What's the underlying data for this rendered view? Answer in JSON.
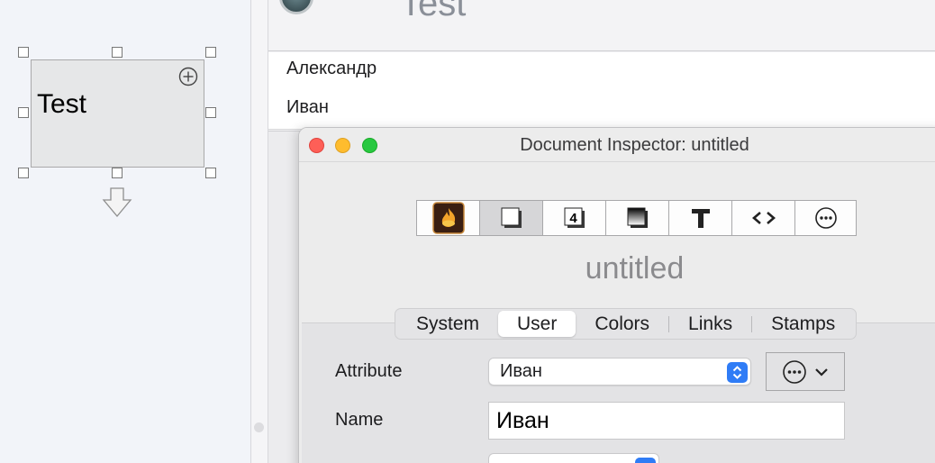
{
  "canvas": {
    "note_title": "Test"
  },
  "main": {
    "title": "Test",
    "list": [
      "Александр",
      "Иван"
    ]
  },
  "inspector": {
    "window_title": "Document Inspector: untitled",
    "toolbar_icons": [
      "document-flame-icon",
      "page-shadow-icon",
      "number-4-icon",
      "gradient-icon",
      "text-T-icon",
      "code-brackets-icon",
      "more-circle-icon"
    ],
    "document_name": "untitled",
    "tabs": [
      {
        "label": "System",
        "selected": false
      },
      {
        "label": "User",
        "selected": true
      },
      {
        "label": "Colors",
        "selected": false
      },
      {
        "label": "Links",
        "selected": false
      },
      {
        "label": "Stamps",
        "selected": false
      }
    ],
    "attribute_label": "Attribute",
    "attribute_value": "Иван",
    "name_label": "Name",
    "name_value": "Иван",
    "accent_color": "#2f7cf6"
  }
}
